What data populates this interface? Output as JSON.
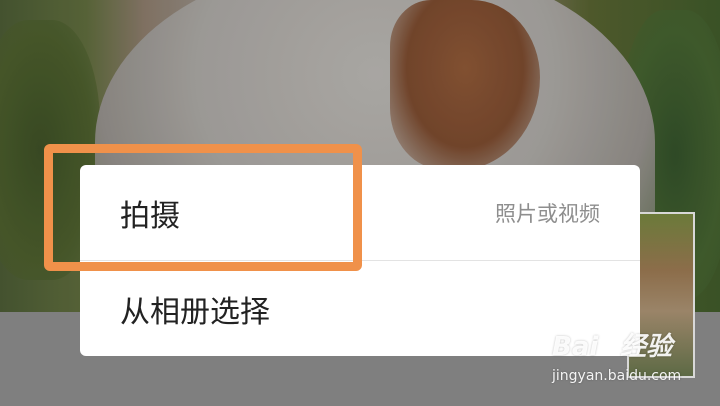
{
  "menu": {
    "items": [
      {
        "label": "拍摄",
        "hint": "照片或视频"
      },
      {
        "label": "从相册选择",
        "hint": ""
      }
    ]
  },
  "watermark": {
    "logo_prefix": "Bai",
    "logo_suffix": "经验",
    "url": "jingyan.baidu.com"
  },
  "colors": {
    "highlight": "#f0914a",
    "overlay": "#7f7f7f",
    "menu_bg": "#ffffff",
    "hint_text": "#8e8e8e"
  }
}
